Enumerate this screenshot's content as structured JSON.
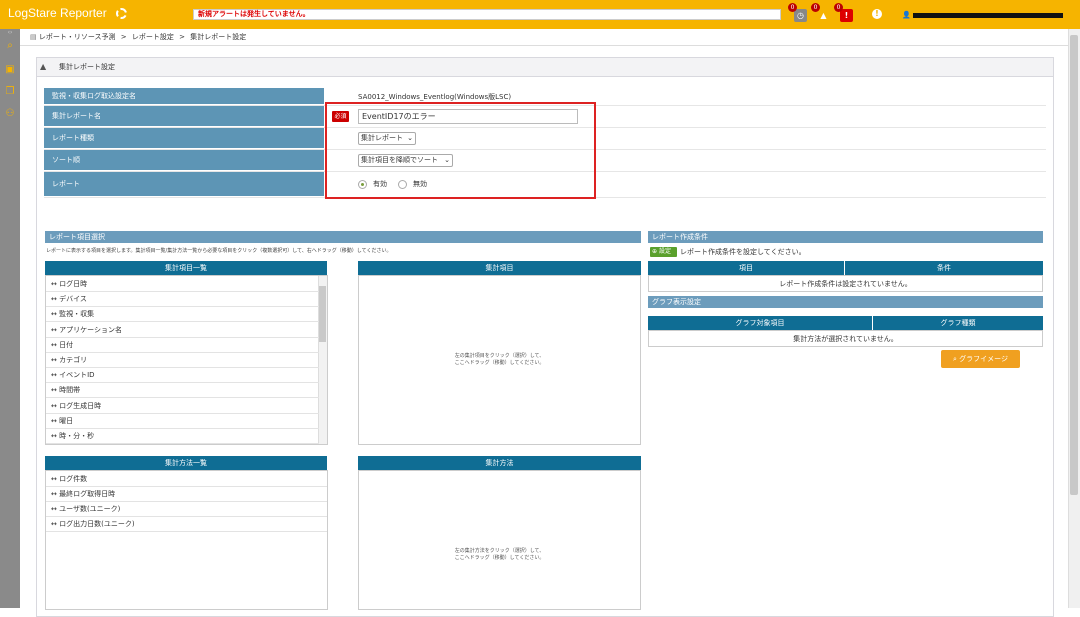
{
  "header": {
    "app_title": "LogStare Reporter",
    "alert_text": "新規アラートは発生していません。",
    "badges": [
      "0",
      "0",
      "0"
    ],
    "user_email": "(redacted)"
  },
  "breadcrumb": {
    "items": [
      "レポート・リソース予測",
      "レポート設定",
      "集計レポート設定"
    ],
    "separator": ">"
  },
  "panel": {
    "title": "集計レポート設定"
  },
  "form": {
    "rows": [
      {
        "label": "監視・収集ログ取込設定名",
        "value": "SA0012_Windows_Eventlog(Windows版LSC)"
      },
      {
        "label": "集計レポート名",
        "required": "必須",
        "value": "EventID17のエラー"
      },
      {
        "label": "レポート種類",
        "value": "集計レポート"
      },
      {
        "label": "ソート順",
        "value": "集計項目を降順でソート"
      },
      {
        "label": "レポート",
        "options": [
          "有効",
          "無効"
        ],
        "selected": "有効"
      }
    ]
  },
  "report_items": {
    "section_title": "レポート項目選択",
    "description": "レポートに表示する項目を選択します。集計項目一覧/集計方法一覧から必要な項目をクリック（複数選択可）して、右へドラッグ（移動）してください。",
    "list_header": "集計項目一覧",
    "items": [
      "ログ日時",
      "デバイス",
      "監視・収集",
      "アプリケーション名",
      "日付",
      "カテゴリ",
      "イベントID",
      "時間帯",
      "ログ生成日時",
      "曜日",
      "時・分・秒"
    ],
    "target_header": "集計項目",
    "target_hint": [
      "左の集計項目をクリック（選択）して、",
      "ここへドラッグ（移動）してください。"
    ],
    "method_header": "集計方法一覧",
    "methods": [
      "ログ件数",
      "最終ログ取得日時",
      "ユーザ数(ユニーク)",
      "ログ出力日数(ユニーク)"
    ],
    "method_target_header": "集計方法",
    "method_target_hint": [
      "左の集計方法をクリック（選択）して、",
      "ここへドラッグ（移動）してください。"
    ]
  },
  "conditions": {
    "section_title": "レポート作成条件",
    "set_button": "設定",
    "set_text": "レポート作成条件を設定してください。",
    "columns": [
      "項目",
      "条件"
    ],
    "empty": "レポート作成条件は設定されていません。"
  },
  "graph": {
    "section_title": "グラフ表示設定",
    "columns": [
      "グラフ対象項目",
      "グラフ種類"
    ],
    "empty": "集計方法が選択されていません。",
    "button": "グラフイメージ"
  },
  "colors": {
    "brand": "#f6b400",
    "label_bg": "#5d95b5",
    "table_head": "#0f6d94",
    "required": "#cc0000",
    "highlight": "#dd2222"
  }
}
